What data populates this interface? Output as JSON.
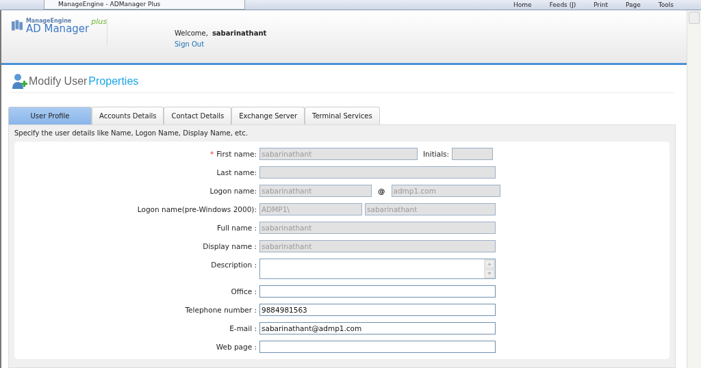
{
  "browser": {
    "tab_title": "ManageEngine - ADManager Plus",
    "toolbar": [
      "Home",
      "Feeds (J)",
      "Print",
      "Page",
      "Tools"
    ]
  },
  "header": {
    "logo_top": "ManageEngine",
    "logo_main": "AD Manager",
    "logo_plus": "plus",
    "welcome": "Welcome,",
    "user": "sabarinathant",
    "sign_out": "Sign Out"
  },
  "page_title": {
    "first": "Modify User",
    "second": "Properties"
  },
  "tabs": [
    {
      "label": "User Profile",
      "selected": true
    },
    {
      "label": "Accounts Details",
      "selected": false
    },
    {
      "label": "Contact Details",
      "selected": false
    },
    {
      "label": "Exchange Server",
      "selected": false
    },
    {
      "label": "Terminal Services",
      "selected": false
    }
  ],
  "hint": "Specify the user details like Name, Logon Name, Display Name, etc.",
  "form": [
    {
      "kind": "first",
      "required": "*",
      "label": "First name:",
      "value": "sabarinathant",
      "disabled": true,
      "extra_label": "Initials:",
      "extra_disabled": true
    },
    {
      "kind": "single",
      "label": "Last name:",
      "disabled": true
    },
    {
      "kind": "pair",
      "label": "Logon name:",
      "value": "sabarinathant",
      "separator": "@",
      "value2": "admp1.com",
      "disabled": true
    },
    {
      "kind": "pair",
      "label": "Logon name(pre-Windows 2000):",
      "value": "ADMP1\\",
      "value2": "sabarinathant",
      "disabled": true
    },
    {
      "kind": "single",
      "label": "Full name :",
      "value": "sabarinathant",
      "disabled": true
    },
    {
      "kind": "single",
      "label": "Display name :",
      "value": "sabarinathant",
      "disabled": true
    },
    {
      "kind": "area",
      "label": "Description :",
      "disabled": false
    },
    {
      "kind": "single",
      "label": "Office :",
      "disabled": false
    },
    {
      "kind": "single",
      "label": "Telephone number :",
      "value": "9884981563",
      "disabled": false
    },
    {
      "kind": "single",
      "label": "E-mail :",
      "value": "sabarinathant@admp1.com",
      "disabled": false
    },
    {
      "kind": "single",
      "label": "Web page :",
      "disabled": false
    }
  ]
}
